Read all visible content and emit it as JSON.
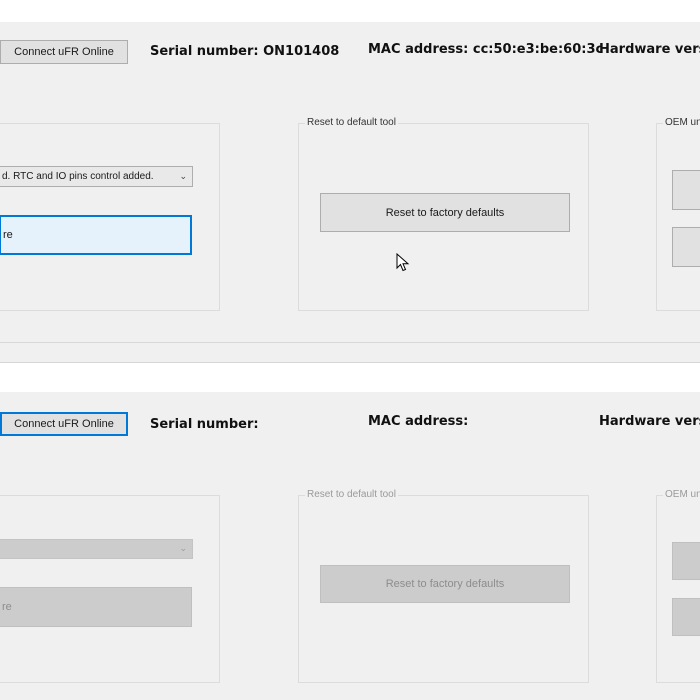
{
  "top": {
    "connect_button": "Connect uFR Online",
    "serial_label": "Serial number: ON101408",
    "mac_label": "MAC address: cc:50:e3:be:60:3c",
    "hardware_label": "Hardware versio",
    "left_group": {
      "combo_value": "d. RTC and IO pins control added.",
      "button_label": "re"
    },
    "reset_group": {
      "title": "Reset to default tool",
      "button_label": "Reset to factory defaults"
    },
    "oem_group": {
      "title": "OEM un"
    }
  },
  "bottom": {
    "connect_button": "Connect uFR Online",
    "serial_label": "Serial number:",
    "mac_label": "MAC address:",
    "hardware_label": "Hardware versio",
    "left_group": {
      "combo_value": "",
      "button_label": "re"
    },
    "reset_group": {
      "title": "Reset to default tool",
      "button_label": "Reset to factory defaults"
    },
    "oem_group": {
      "title": "OEM un"
    }
  }
}
